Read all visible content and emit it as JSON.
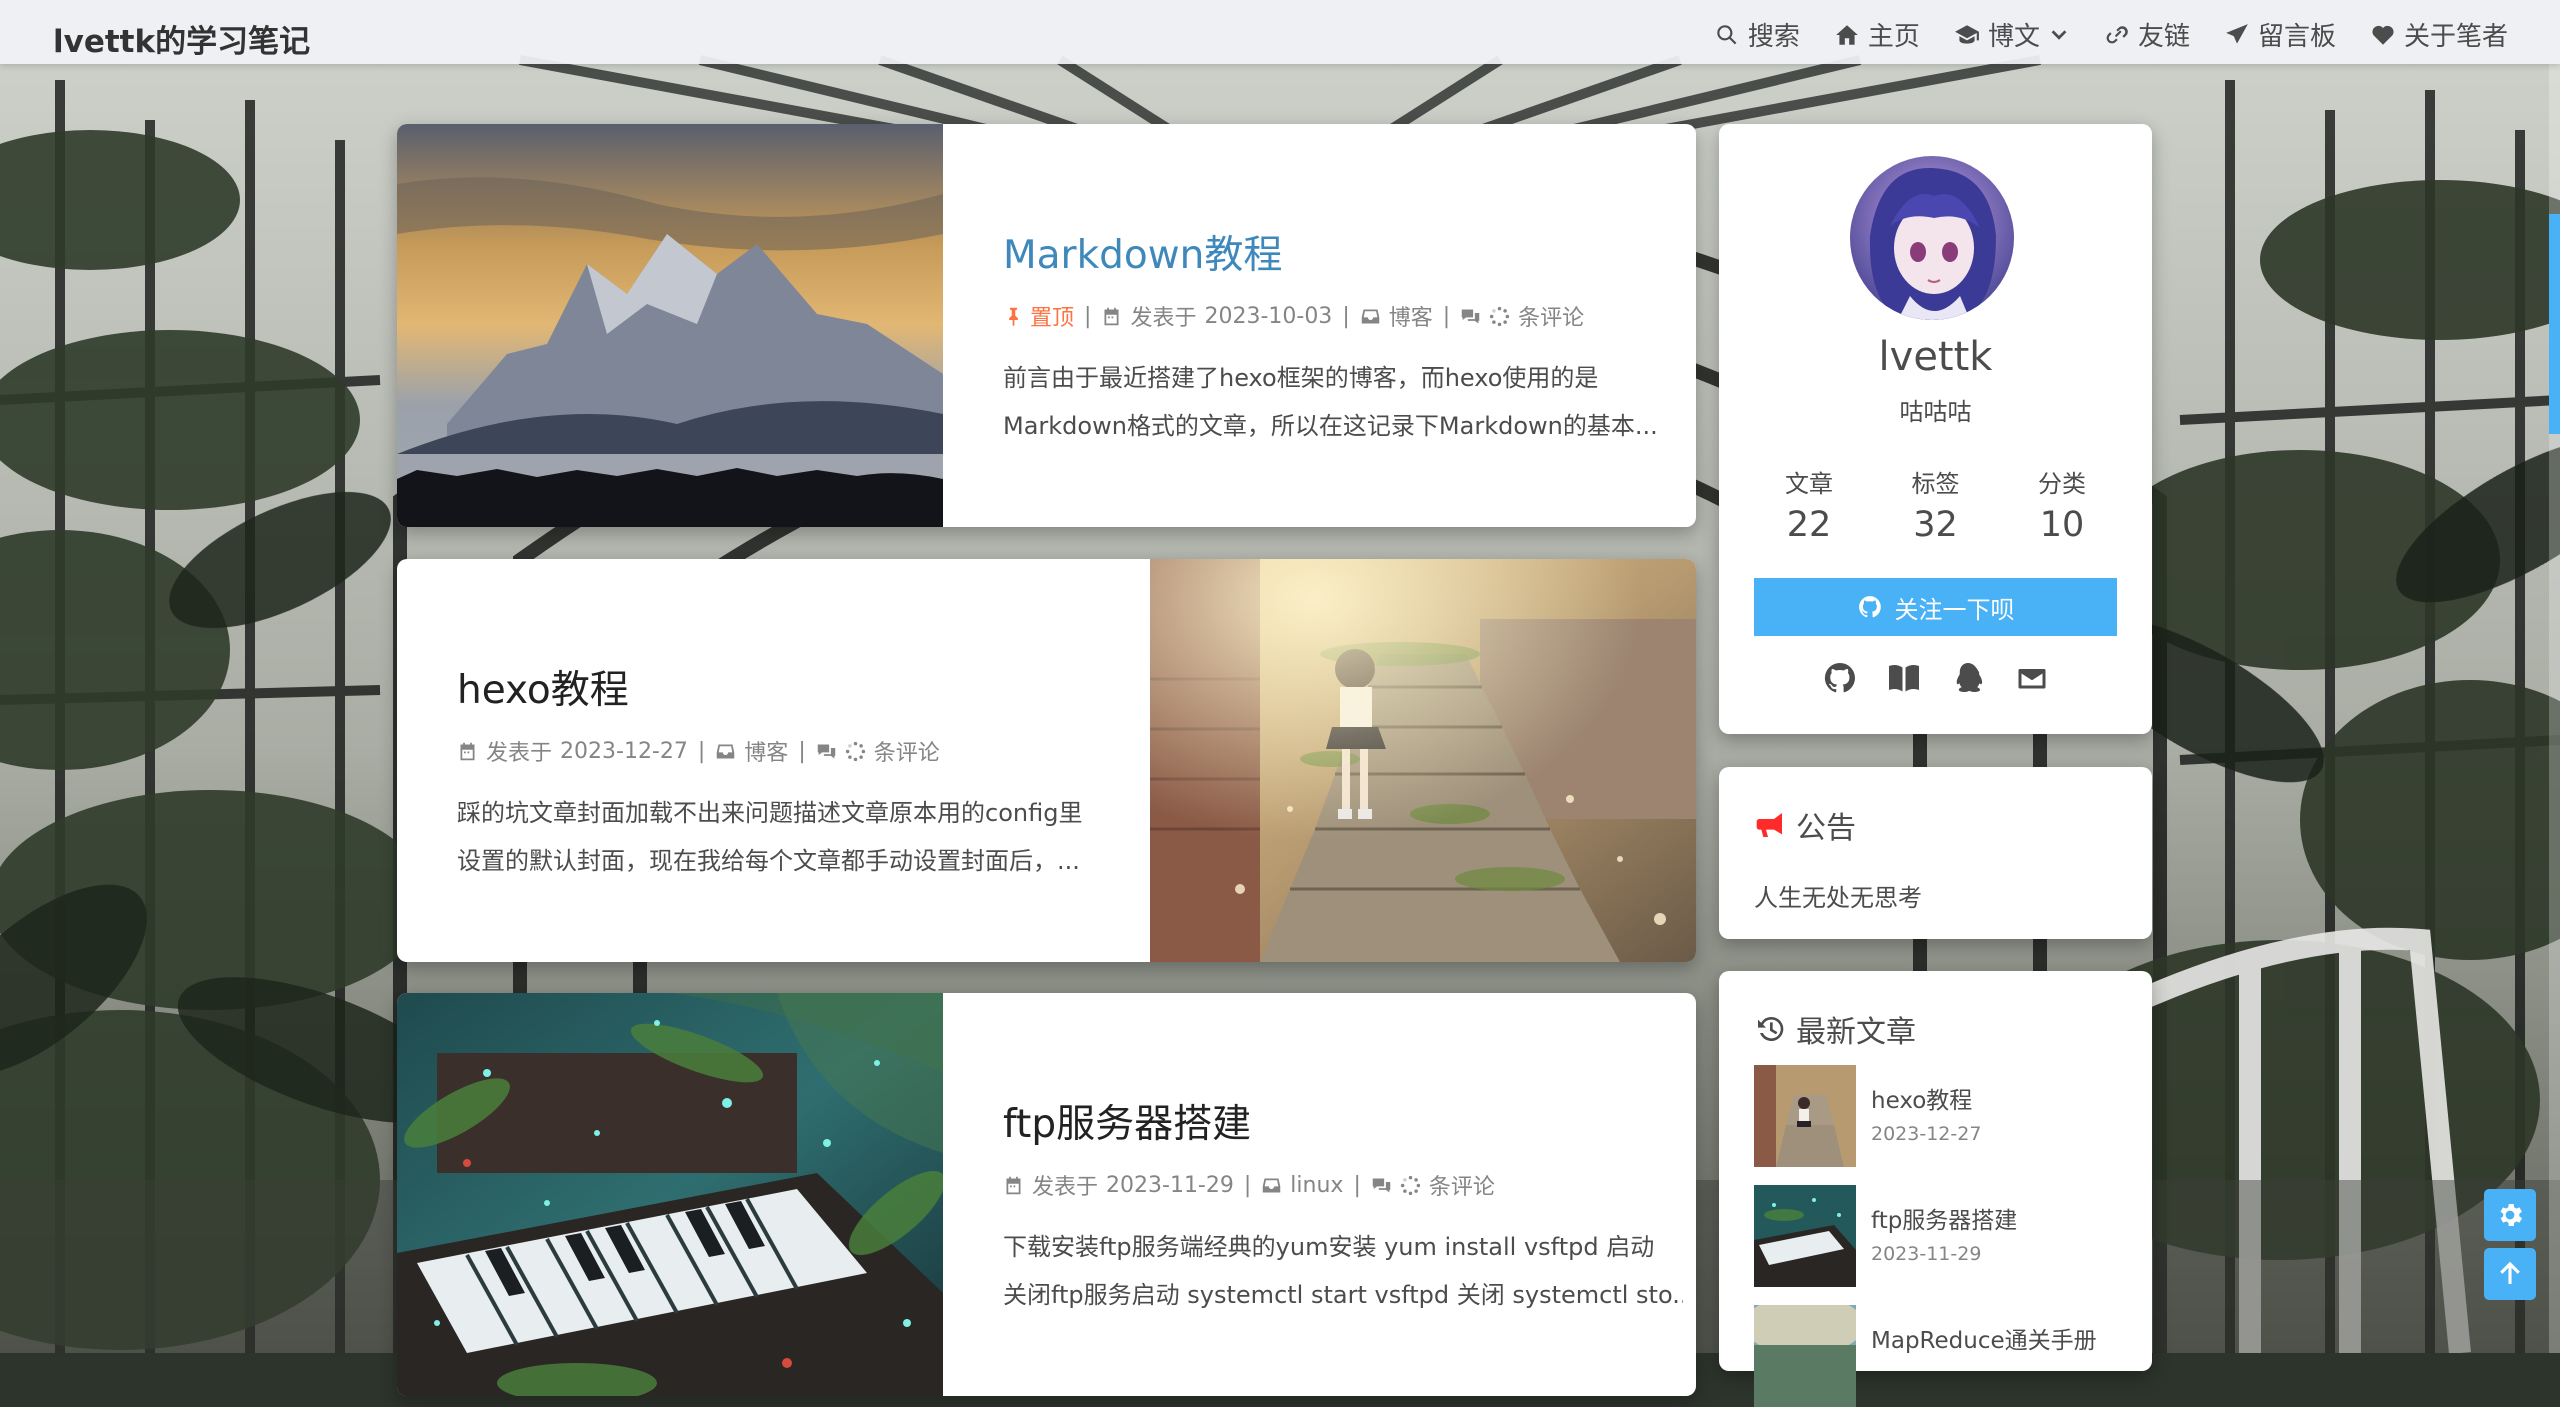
{
  "site": {
    "title": "lvettk的学习笔记"
  },
  "nav": {
    "items": [
      {
        "label": "搜索",
        "icon": "search-icon"
      },
      {
        "label": "主页",
        "icon": "home-icon"
      },
      {
        "label": "博文",
        "icon": "graduation-cap-icon",
        "dropdown": true
      },
      {
        "label": "友链",
        "icon": "link-icon"
      },
      {
        "label": "留言板",
        "icon": "paper-plane-icon"
      },
      {
        "label": "关于笔者",
        "icon": "heart-icon"
      }
    ]
  },
  "posts": [
    {
      "title": "Markdown教程",
      "sticky_label": "置顶",
      "date_prefix": "发表于",
      "date": "2023-10-03",
      "category": "博客",
      "comments_label": "条评论",
      "excerpt": [
        "前言由于最近搭建了hexo框架的博客，而hexo使用的是",
        "Markdown格式的文章，所以在这记录下Markdown的基本..."
      ],
      "cover": "mountain-sunset-image"
    },
    {
      "title": "hexo教程",
      "date_prefix": "发表于",
      "date": "2023-12-27",
      "category": "博客",
      "comments_label": "条评论",
      "excerpt": [
        "踩的坑文章封面加载不出来问题描述文章原本用的config里",
        "设置的默认封面，现在我给每个文章都手动设置封面后，..."
      ],
      "cover": "anime-girl-on-stairs-image"
    },
    {
      "title": "ftp服务器搭建",
      "date_prefix": "发表于",
      "date": "2023-11-29",
      "category": "linux",
      "comments_label": "条评论",
      "excerpt": [
        "下载安装ftp服务端经典的yum安装 yum install vsftpd 启动",
        "关闭ftp服务启动 systemctl start vsftpd 关闭 systemctl sto..."
      ],
      "cover": "overgrown-piano-image"
    }
  ],
  "author": {
    "name": "lvettk",
    "description": "咕咕咕",
    "stats": [
      {
        "label": "文章",
        "value": "22"
      },
      {
        "label": "标签",
        "value": "32"
      },
      {
        "label": "分类",
        "value": "10"
      }
    ],
    "follow_label": "关注一下呗",
    "social_icons": [
      "github-icon",
      "book-icon",
      "qq-icon",
      "mail-icon"
    ]
  },
  "announcement": {
    "title": "公告",
    "text": "人生无处无思考"
  },
  "recent": {
    "title": "最新文章",
    "items": [
      {
        "title": "hexo教程",
        "date": "2023-12-27"
      },
      {
        "title": "ftp服务器搭建",
        "date": "2023-11-29"
      },
      {
        "title": "MapReduce通关手册",
        "date": ""
      }
    ]
  },
  "colors": {
    "accent": "#49b1f5",
    "active_title": "#3f88bb",
    "sticky": "#ff7242",
    "announce_icon": "#ff2a2a"
  }
}
